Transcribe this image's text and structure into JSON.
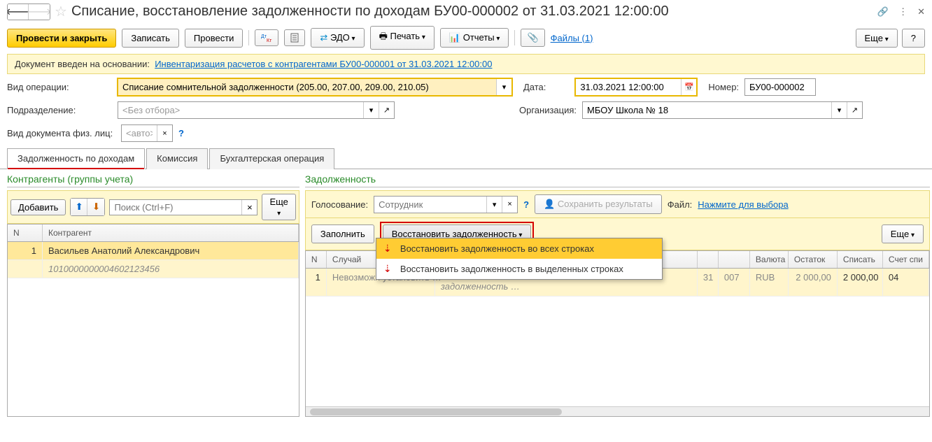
{
  "header": {
    "title": "Списание, восстановление задолженности по доходам БУ00-000002 от 31.03.2021 12:00:00"
  },
  "toolbar": {
    "post_close": "Провести и закрыть",
    "save": "Записать",
    "post": "Провести",
    "edo": "ЭДО",
    "print": "Печать",
    "reports": "Отчеты",
    "files": "Файлы (1)",
    "more": "Еще",
    "help": "?"
  },
  "basis": {
    "label": "Документ введен на основании:",
    "link": "Инвентаризация расчетов с контрагентами БУ00-000001 от 31.03.2021 12:00:00"
  },
  "fields": {
    "operation_label": "Вид операции:",
    "operation_value": "Списание сомнительной задолженности (205.00, 207.00, 209.00, 210.05)",
    "date_label": "Дата:",
    "date_value": "31.03.2021 12:00:00",
    "number_label": "Номер:",
    "number_value": "БУ00-000002",
    "subdivision_label": "Подразделение:",
    "subdivision_placeholder": "<Без отбора>",
    "org_label": "Организация:",
    "org_value": "МБОУ Школа № 18",
    "doctype_label": "Вид документа физ. лиц:",
    "doctype_placeholder": "<авто>"
  },
  "tabs": {
    "t1": "Задолженность по доходам",
    "t2": "Комиссия",
    "t3": "Бухгалтерская операция"
  },
  "left_pane": {
    "title": "Контрагенты (группы учета)",
    "add": "Добавить",
    "search_placeholder": "Поиск (Ctrl+F)",
    "more": "Еще",
    "col_n": "N",
    "col_name": "Контрагент",
    "rows": [
      {
        "n": "1",
        "name": "Васильев Анатолий Александрович",
        "code": "1010000000004602123456"
      }
    ]
  },
  "right_pane": {
    "title": "Задолженность",
    "vote_label": "Голосование:",
    "vote_placeholder": "Сотрудник",
    "save_results": "Сохранить результаты",
    "file_label": "Файл:",
    "file_link": "Нажмите для выбора",
    "fill": "Заполнить",
    "restore": "Восстановить задолженность",
    "more": "Еще",
    "dropdown": {
      "opt1": "Восстановить задолженность во всех строках",
      "opt2": "Восстановить задолженность в выделенных строках"
    },
    "cols": {
      "n": "N",
      "case": "Случай",
      "debt": "задолженность …",
      "d1": "31",
      "acc": "007",
      "cur": "Валюта",
      "rest": "Остаток",
      "write": "Списать",
      "acc2": "Счет спи"
    },
    "row": {
      "n": "1",
      "case": "Невозможн установить …",
      "d1": "31",
      "acc": "007",
      "cur": "RUB",
      "rest": "2 000,00",
      "write": "2 000,00",
      "acc2": "04"
    }
  }
}
